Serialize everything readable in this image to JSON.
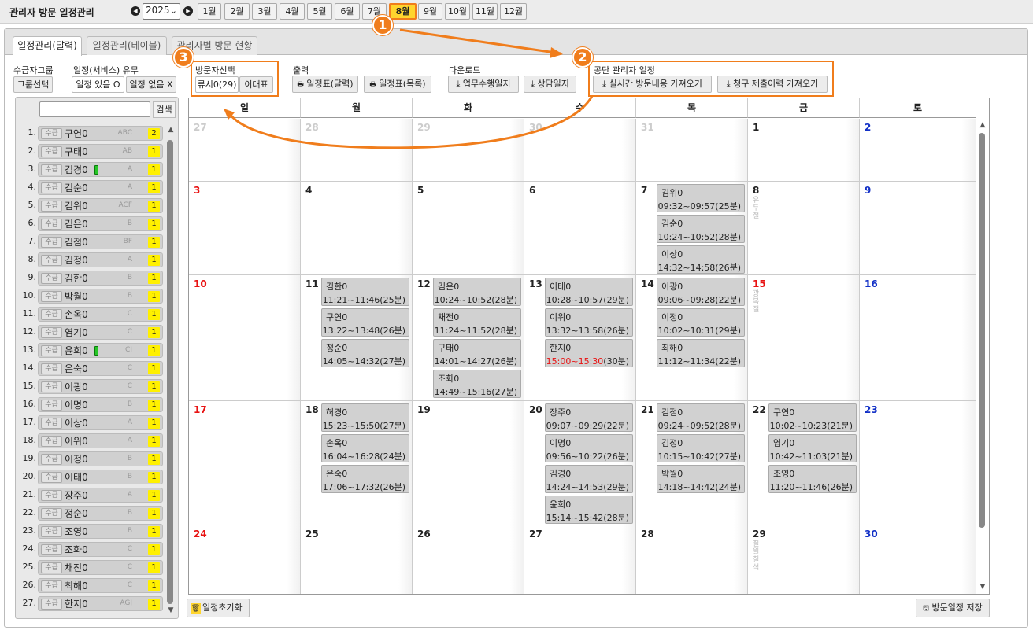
{
  "header": {
    "title": "관리자 방문 일정관리",
    "prev_icon": "chevron-left-icon",
    "next_icon": "chevron-right-icon",
    "year": "2025",
    "months": [
      "1월",
      "2월",
      "3월",
      "4월",
      "5월",
      "6월",
      "7월",
      "8월",
      "9월",
      "10월",
      "11월",
      "12월"
    ],
    "active_month": "8월"
  },
  "tabs": [
    "일정관리(달력)",
    "일정관리(테이블)",
    "관리자별 방문 현황"
  ],
  "filters": {
    "group_label": "수급자그룹",
    "group_button": "그룹선택",
    "service_label": "일정(서비스) 유무",
    "has_schedule": "일정 있음 O",
    "no_schedule": "일정 없음 X",
    "visitor_label": "방문자선택",
    "visitor_button_1": "류시0(29)",
    "visitor_button_2": "이대표",
    "print_label": "출력",
    "print_calendar": "일정표(달력)",
    "print_list": "일정표(목록)",
    "download_label": "다운로드",
    "download_work": "업무수행일지",
    "download_consult": "상담일지",
    "gongdan_label": "공단 관리자 일정",
    "gongdan_realtime": "실시간 방문내용 가져오기",
    "gongdan_claim": "청구 제출이력 가져오기"
  },
  "sidebar": {
    "search_placeholder": "",
    "search_button": "검색",
    "tag": "수급",
    "clients": [
      {
        "num": "1.",
        "name": "구연0",
        "code": "ABC",
        "count": "2",
        "indicator": false
      },
      {
        "num": "2.",
        "name": "구태0",
        "code": "AB",
        "count": "1",
        "indicator": false
      },
      {
        "num": "3.",
        "name": "김경0",
        "code": "A",
        "count": "1",
        "indicator": true
      },
      {
        "num": "4.",
        "name": "김순0",
        "code": "A",
        "count": "1",
        "indicator": false
      },
      {
        "num": "5.",
        "name": "김위0",
        "code": "ACF",
        "count": "1",
        "indicator": false
      },
      {
        "num": "6.",
        "name": "김은0",
        "code": "B",
        "count": "1",
        "indicator": false
      },
      {
        "num": "7.",
        "name": "김점0",
        "code": "BF",
        "count": "1",
        "indicator": false
      },
      {
        "num": "8.",
        "name": "김정0",
        "code": "A",
        "count": "1",
        "indicator": false
      },
      {
        "num": "9.",
        "name": "김한0",
        "code": "B",
        "count": "1",
        "indicator": false
      },
      {
        "num": "10.",
        "name": "박월0",
        "code": "B",
        "count": "1",
        "indicator": false
      },
      {
        "num": "11.",
        "name": "손옥0",
        "code": "C",
        "count": "1",
        "indicator": false
      },
      {
        "num": "12.",
        "name": "염기0",
        "code": "C",
        "count": "1",
        "indicator": false
      },
      {
        "num": "13.",
        "name": "윤희0",
        "code": "CI",
        "count": "1",
        "indicator": true
      },
      {
        "num": "14.",
        "name": "은숙0",
        "code": "C",
        "count": "1",
        "indicator": false
      },
      {
        "num": "15.",
        "name": "이광0",
        "code": "C",
        "count": "1",
        "indicator": false
      },
      {
        "num": "16.",
        "name": "이명0",
        "code": "B",
        "count": "1",
        "indicator": false
      },
      {
        "num": "17.",
        "name": "이상0",
        "code": "A",
        "count": "1",
        "indicator": false
      },
      {
        "num": "18.",
        "name": "이위0",
        "code": "A",
        "count": "1",
        "indicator": false
      },
      {
        "num": "19.",
        "name": "이정0",
        "code": "B",
        "count": "1",
        "indicator": false
      },
      {
        "num": "20.",
        "name": "이태0",
        "code": "B",
        "count": "1",
        "indicator": false
      },
      {
        "num": "21.",
        "name": "장주0",
        "code": "A",
        "count": "1",
        "indicator": false
      },
      {
        "num": "22.",
        "name": "정순0",
        "code": "B",
        "count": "1",
        "indicator": false
      },
      {
        "num": "23.",
        "name": "조영0",
        "code": "B",
        "count": "1",
        "indicator": false
      },
      {
        "num": "24.",
        "name": "조화0",
        "code": "C",
        "count": "1",
        "indicator": false
      },
      {
        "num": "25.",
        "name": "채전0",
        "code": "C",
        "count": "1",
        "indicator": false
      },
      {
        "num": "26.",
        "name": "최해0",
        "code": "C",
        "count": "1",
        "indicator": false
      },
      {
        "num": "27.",
        "name": "한지0",
        "code": "AGJ",
        "count": "1",
        "indicator": false
      }
    ]
  },
  "calendar": {
    "weekdays": [
      "일",
      "월",
      "화",
      "수",
      "목",
      "금",
      "토"
    ],
    "weeks": [
      [
        {
          "d": "27",
          "other": true
        },
        {
          "d": "28",
          "other": true
        },
        {
          "d": "29",
          "other": true
        },
        {
          "d": "30",
          "other": true
        },
        {
          "d": "31",
          "other": true
        },
        {
          "d": "1"
        },
        {
          "d": "2"
        }
      ],
      [
        {
          "d": "3"
        },
        {
          "d": "4"
        },
        {
          "d": "5"
        },
        {
          "d": "6"
        },
        {
          "d": "7",
          "events": [
            {
              "n": "김위0",
              "t": "09:32~09:57",
              "m": "(25분)"
            },
            {
              "n": "김순0",
              "t": "10:24~10:52",
              "m": "(28분)"
            },
            {
              "n": "이상0",
              "t": "14:32~14:58",
              "m": "(26분)"
            }
          ]
        },
        {
          "d": "8",
          "holiday": "유두절"
        },
        {
          "d": "9"
        }
      ],
      [
        {
          "d": "10"
        },
        {
          "d": "11",
          "events": [
            {
              "n": "김한0",
              "t": "11:21~11:46",
              "m": "(25분)"
            },
            {
              "n": "구연0",
              "t": "13:22~13:48",
              "m": "(26분)"
            },
            {
              "n": "정순0",
              "t": "14:05~14:32",
              "m": "(27분)"
            }
          ]
        },
        {
          "d": "12",
          "events": [
            {
              "n": "김은0",
              "t": "10:24~10:52",
              "m": "(28분)"
            },
            {
              "n": "채전0",
              "t": "11:24~11:52",
              "m": "(28분)"
            },
            {
              "n": "구태0",
              "t": "14:01~14:27",
              "m": "(26분)"
            },
            {
              "n": "조화0",
              "t": "14:49~15:16",
              "m": "(27분)"
            }
          ]
        },
        {
          "d": "13",
          "events": [
            {
              "n": "이태0",
              "t": "10:28~10:57",
              "m": "(29분)"
            },
            {
              "n": "이위0",
              "t": "13:32~13:58",
              "m": "(26분)"
            },
            {
              "n": "한지0",
              "t": "15:00~15:30",
              "m": "(30분)",
              "red": true
            }
          ]
        },
        {
          "d": "14",
          "events": [
            {
              "n": "이광0",
              "t": "09:06~09:28",
              "m": "(22분)"
            },
            {
              "n": "이정0",
              "t": "10:02~10:31",
              "m": "(29분)"
            },
            {
              "n": "최해0",
              "t": "11:12~11:34",
              "m": "(22분)"
            }
          ]
        },
        {
          "d": "15",
          "holiday": "광복절",
          "red": true
        },
        {
          "d": "16"
        }
      ],
      [
        {
          "d": "17"
        },
        {
          "d": "18",
          "events": [
            {
              "n": "허경0",
              "t": "15:23~15:50",
              "m": "(27분)"
            },
            {
              "n": "손옥0",
              "t": "16:04~16:28",
              "m": "(24분)"
            },
            {
              "n": "은숙0",
              "t": "17:06~17:32",
              "m": "(26분)"
            }
          ]
        },
        {
          "d": "19"
        },
        {
          "d": "20",
          "events": [
            {
              "n": "장주0",
              "t": "09:07~09:29",
              "m": "(22분)"
            },
            {
              "n": "이명0",
              "t": "09:56~10:22",
              "m": "(26분)"
            },
            {
              "n": "김경0",
              "t": "14:24~14:53",
              "m": "(29분)"
            },
            {
              "n": "윤희0",
              "t": "15:14~15:42",
              "m": "(28분)"
            }
          ]
        },
        {
          "d": "21",
          "events": [
            {
              "n": "김점0",
              "t": "09:24~09:52",
              "m": "(28분)"
            },
            {
              "n": "김정0",
              "t": "10:15~10:42",
              "m": "(27분)"
            },
            {
              "n": "박월0",
              "t": "14:18~14:42",
              "m": "(24분)"
            }
          ]
        },
        {
          "d": "22",
          "events": [
            {
              "n": "구연0",
              "t": "10:02~10:23",
              "m": "(21분)"
            },
            {
              "n": "염기0",
              "t": "10:42~11:03",
              "m": "(21분)"
            },
            {
              "n": "조영0",
              "t": "11:20~11:46",
              "m": "(26분)"
            }
          ]
        },
        {
          "d": "23"
        }
      ],
      [
        {
          "d": "24"
        },
        {
          "d": "25"
        },
        {
          "d": "26"
        },
        {
          "d": "27"
        },
        {
          "d": "28"
        },
        {
          "d": "29",
          "holiday": "칠월칠석"
        },
        {
          "d": "30"
        }
      ]
    ]
  },
  "footer": {
    "reset_button": "일정초기화",
    "save_button": "방문일정 저장"
  },
  "annotations": [
    "1",
    "2",
    "3"
  ],
  "colors": {
    "accent": "#f07d1c",
    "active_month": "#ffd52e",
    "sunday": "#e81313",
    "saturday": "#1331c7",
    "count_badge": "#fff000",
    "indicator": "#26c626"
  }
}
